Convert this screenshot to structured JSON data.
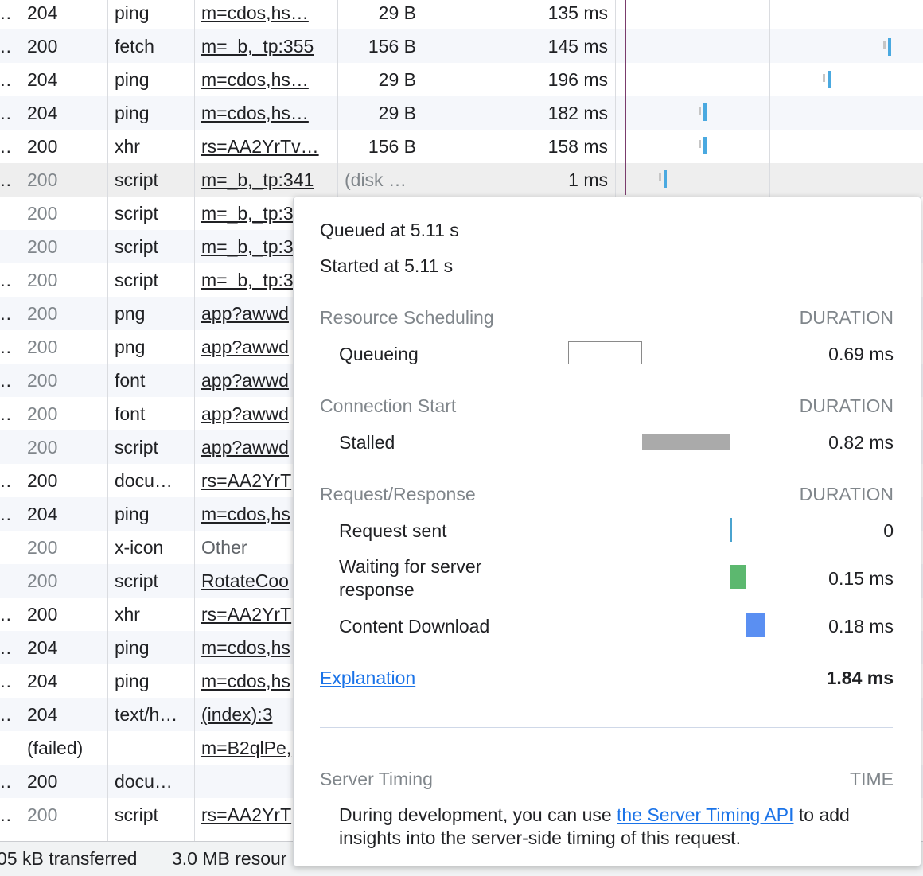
{
  "colors": {
    "stalled_bar": "#aaaaaa",
    "waiting_bar": "#5cb86f",
    "download_bar": "#5a8ff2",
    "request_sent_line": "#4aa3cf",
    "link": "#1a73e8",
    "marker_line": "#7a3c6c"
  },
  "table": {
    "rows": [
      {
        "init": "…",
        "status": "204",
        "type": "ping",
        "name": "m=cdos,hs…",
        "size": "29 B",
        "time": "135 ms",
        "muted": false
      },
      {
        "init": "…",
        "status": "200",
        "type": "fetch",
        "name": "m=_b,_tp:355",
        "size": "156 B",
        "time": "145 ms",
        "muted": false
      },
      {
        "init": "…",
        "status": "204",
        "type": "ping",
        "name": "m=cdos,hs…",
        "size": "29 B",
        "time": "196 ms",
        "muted": false
      },
      {
        "init": "…",
        "status": "204",
        "type": "ping",
        "name": "m=cdos,hs…",
        "size": "29 B",
        "time": "182 ms",
        "muted": false
      },
      {
        "init": "…",
        "status": "200",
        "type": "xhr",
        "name": "rs=AA2YrTv…",
        "size": "156 B",
        "time": "158 ms",
        "muted": false
      },
      {
        "init": "…",
        "status": "200",
        "type": "script",
        "name": "m=_b,_tp:341",
        "size": "(disk …",
        "time": "1 ms",
        "muted": true
      },
      {
        "init": "",
        "status": "200",
        "type": "script",
        "name": "m=_b,_tp:3",
        "size": "",
        "time": "",
        "muted": true
      },
      {
        "init": "",
        "status": "200",
        "type": "script",
        "name": "m=_b,_tp:3",
        "size": "",
        "time": "",
        "muted": true
      },
      {
        "init": "…",
        "status": "200",
        "type": "script",
        "name": "m=_b,_tp:3",
        "size": "",
        "time": "",
        "muted": true
      },
      {
        "init": "…",
        "status": "200",
        "type": "png",
        "name": "app?awwd",
        "size": "",
        "time": "",
        "muted": true
      },
      {
        "init": "…",
        "status": "200",
        "type": "png",
        "name": "app?awwd",
        "size": "",
        "time": "",
        "muted": true
      },
      {
        "init": "…",
        "status": "200",
        "type": "font",
        "name": "app?awwd",
        "size": "",
        "time": "",
        "muted": true
      },
      {
        "init": "…",
        "status": "200",
        "type": "font",
        "name": "app?awwd",
        "size": "",
        "time": "",
        "muted": true
      },
      {
        "init": "",
        "status": "200",
        "type": "script",
        "name": "app?awwd",
        "size": "",
        "time": "",
        "muted": true
      },
      {
        "init": "…",
        "status": "200",
        "type": "docu…",
        "name": "rs=AA2YrT",
        "size": "",
        "time": "",
        "muted": false
      },
      {
        "init": "…",
        "status": "204",
        "type": "ping",
        "name": "m=cdos,hs",
        "size": "",
        "time": "",
        "muted": false
      },
      {
        "init": "",
        "status": "200",
        "type": "x-icon",
        "name": "Other",
        "size": "",
        "time": "",
        "muted": true
      },
      {
        "init": "",
        "status": "200",
        "type": "script",
        "name": "RotateCoo",
        "size": "",
        "time": "",
        "muted": true
      },
      {
        "init": "…",
        "status": "200",
        "type": "xhr",
        "name": "rs=AA2YrT",
        "size": "",
        "time": "",
        "muted": false
      },
      {
        "init": "…",
        "status": "204",
        "type": "ping",
        "name": "m=cdos,hs",
        "size": "",
        "time": "",
        "muted": false
      },
      {
        "init": "…",
        "status": "204",
        "type": "ping",
        "name": "m=cdos,hs",
        "size": "",
        "time": "",
        "muted": false
      },
      {
        "init": "…",
        "status": "204",
        "type": "text/h…",
        "name": "(index):3",
        "size": "",
        "time": "",
        "muted": false
      },
      {
        "init": "",
        "status": "(failed)",
        "type": "",
        "name": "m=B2qlPe,",
        "size": "",
        "time": "",
        "muted": false
      },
      {
        "init": "…",
        "status": "200",
        "type": "docu…",
        "name": "",
        "size": "",
        "time": "",
        "muted": false
      },
      {
        "init": "…",
        "status": "200",
        "type": "script",
        "name": "rs=AA2YrT",
        "size": "",
        "time": "",
        "muted": true
      }
    ]
  },
  "footer": {
    "transferred": "05 kB transferred",
    "resources": "3.0 MB resour"
  },
  "popover": {
    "queued": "Queued at 5.11 s",
    "started": "Started at 5.11 s",
    "sections": {
      "scheduling": {
        "title": "Resource Scheduling",
        "head": "DURATION",
        "queueing_label": "Queueing",
        "queueing_value": "0.69 ms"
      },
      "connection": {
        "title": "Connection Start",
        "head": "DURATION",
        "stalled_label": "Stalled",
        "stalled_value": "0.82 ms"
      },
      "request": {
        "title": "Request/Response",
        "head": "DURATION",
        "sent_label": "Request sent",
        "sent_value": "0",
        "waiting_label_1": "Waiting for server",
        "waiting_label_2": "response",
        "waiting_value": "0.15 ms",
        "download_label": "Content Download",
        "download_value": "0.18 ms"
      }
    },
    "explanation": "Explanation",
    "total": "1.84 ms",
    "server_timing": {
      "title": "Server Timing",
      "head": "TIME",
      "text_before": "During development, you can use ",
      "link": "the Server Timing API",
      "text_after": " to add",
      "line2": "insights into the server-side timing of this request."
    }
  }
}
